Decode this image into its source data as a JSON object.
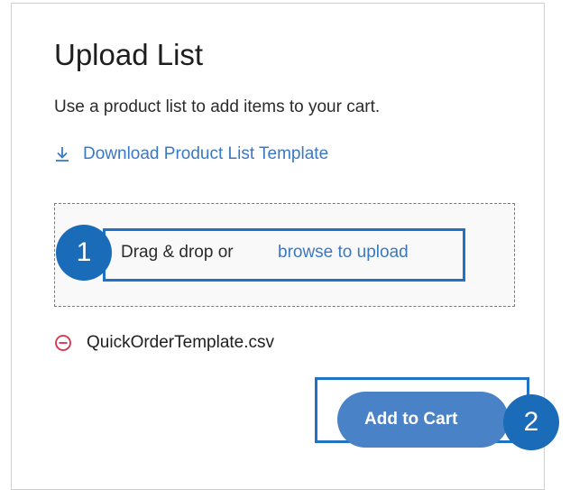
{
  "upload": {
    "title": "Upload List",
    "subtitle": "Use a product list to add items to your cart.",
    "download_link": "Download Product List Template",
    "dropzone": {
      "prefix": "Drag & drop or",
      "browse_link": "browse to upload"
    },
    "file": {
      "name": "QuickOrderTemplate.csv"
    },
    "add_to_cart": "Add to Cart"
  },
  "annotations": {
    "step1": "1",
    "step2": "2"
  },
  "icons": {
    "download": "download-icon",
    "remove": "remove-circle-icon"
  },
  "colors": {
    "link": "#3b78c2",
    "remove": "#d8304a",
    "button": "#4a82c8",
    "annotation": "#1a6bb8"
  }
}
